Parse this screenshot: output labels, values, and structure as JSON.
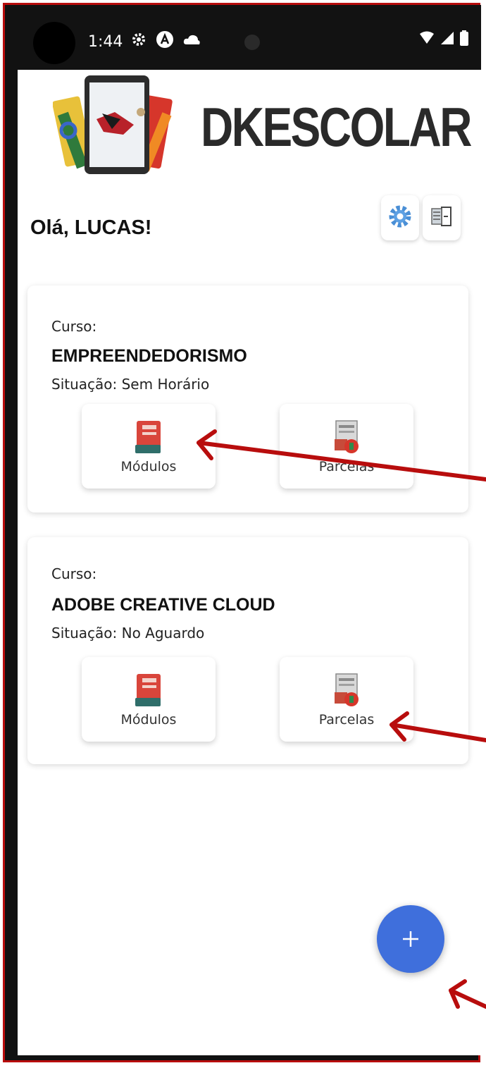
{
  "status_bar": {
    "time": "1:44",
    "left_icons": [
      "gear-icon",
      "a-circle-icon",
      "cloud-icon"
    ],
    "right_icons": [
      "wifi-icon",
      "signal-icon",
      "battery-icon"
    ]
  },
  "header": {
    "logo_text": "DKESCOLAR",
    "greeting": "Olá, LUCAS!",
    "settings_icon": "gear-icon",
    "logout_icon": "exit-door-icon"
  },
  "courses": [
    {
      "label": "Curso:",
      "name": "EMPREENDEDORISMO",
      "status": "Situação: Sem Horário",
      "modules_label": "Módulos",
      "installments_label": "Parcelas"
    },
    {
      "label": "Curso:",
      "name": "ADOBE CREATIVE CLOUD",
      "status": "Situação: No Aguardo",
      "modules_label": "Módulos",
      "installments_label": "Parcelas"
    }
  ],
  "fab": {
    "icon": "plus-icon"
  },
  "colors": {
    "frame_border": "#b80d0d",
    "fab": "#3f6fdc",
    "annotation_arrow": "#b80d0d"
  }
}
